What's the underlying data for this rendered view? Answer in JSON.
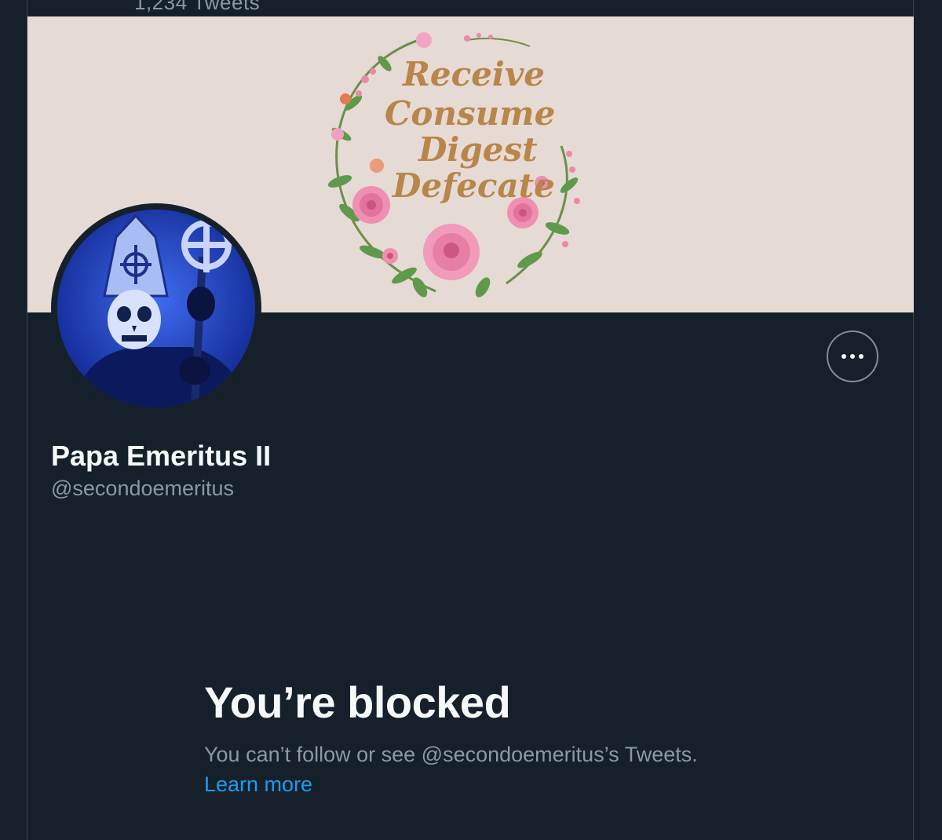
{
  "header": {
    "tweet_count": "1,234 Tweets"
  },
  "banner": {
    "lines": [
      "Receive",
      "Consume",
      "Digest",
      "Defecate"
    ],
    "background_color": "#e6dad4",
    "text_color": "#b8864a"
  },
  "profile": {
    "display_name": "Papa Emeritus II",
    "handle": "@secondoemeritus",
    "more_icon": "more-horizontal-icon"
  },
  "blocked": {
    "title": "You’re blocked",
    "description": "You can’t follow or see @secondoemeritus’s Tweets.",
    "learn_more": "Learn more"
  },
  "colors": {
    "background": "#15202b",
    "primary_text": "#f7f9f9",
    "secondary_text": "#8b98a5",
    "link": "#1d9bf0",
    "border": "#38444d"
  }
}
